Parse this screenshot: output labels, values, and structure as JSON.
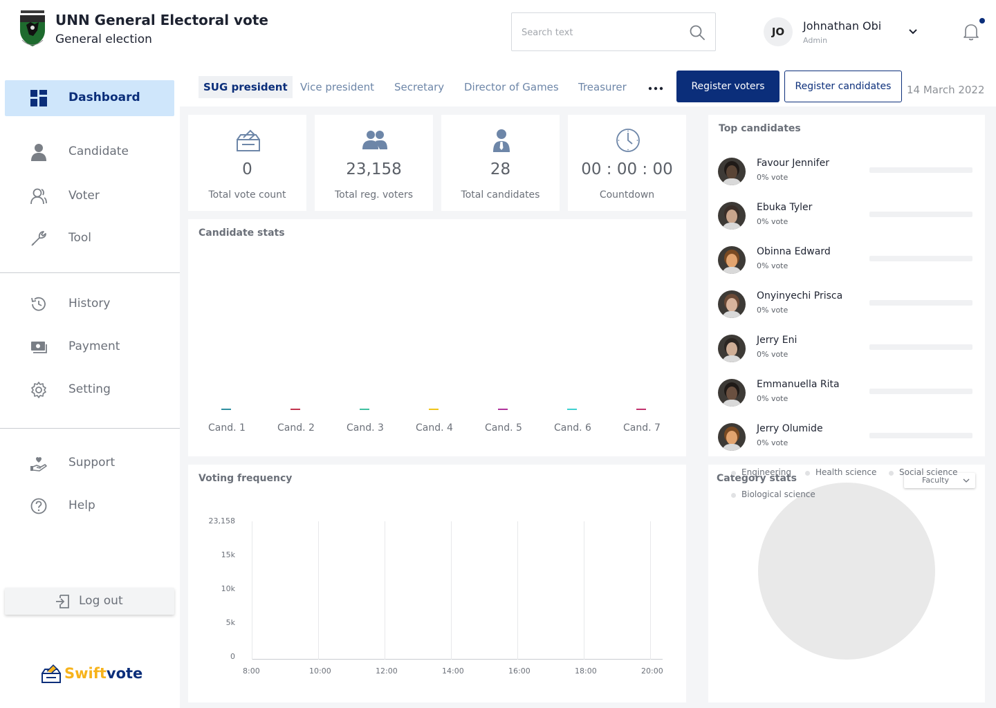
{
  "header": {
    "app_title": "UNN General Electoral vote",
    "app_subtitle": "General election",
    "search_placeholder": "Search text",
    "user": {
      "initials": "JO",
      "name": "Johnathan Obi",
      "role": "Admin"
    }
  },
  "sidebar": {
    "items": [
      {
        "label": "Dashboard",
        "icon": "dashboard-icon",
        "active": true
      },
      {
        "label": "Candidate",
        "icon": "candidate-icon"
      },
      {
        "label": "Voter",
        "icon": "voter-icon"
      },
      {
        "label": "Tool",
        "icon": "wrench-icon"
      },
      {
        "label": "History",
        "icon": "history-icon"
      },
      {
        "label": "Payment",
        "icon": "payment-icon"
      },
      {
        "label": "Setting",
        "icon": "gear-icon"
      },
      {
        "label": "Support",
        "icon": "support-icon"
      },
      {
        "label": "Help",
        "icon": "help-icon"
      }
    ],
    "logout_label": "Log out",
    "brand_a": "Swift",
    "brand_b": "vote"
  },
  "tabs": {
    "items": [
      "SUG president",
      "Vice president",
      "Secretary",
      "Director of Games",
      "Treasurer"
    ],
    "active": "SUG president",
    "register_voters": "Register voters",
    "register_candidates": "Register candidates",
    "date": "14 March 2022"
  },
  "stats": [
    {
      "value": "0",
      "label": "Total vote count",
      "icon": "ballot-box-icon"
    },
    {
      "value": "23,158",
      "label": "Total reg. voters",
      "icon": "users-icon"
    },
    {
      "value": "28",
      "label": "Total candidates",
      "icon": "user-tie-icon"
    },
    {
      "value": "00 : 00 : 00",
      "label": "Countdown",
      "icon": "clock-icon"
    }
  ],
  "candidate_stats": {
    "title": "Candidate stats",
    "chart_data": {
      "type": "bar",
      "categories": [
        "Cand. 1",
        "Cand. 2",
        "Cand. 3",
        "Cand. 4",
        "Cand. 5",
        "Cand. 6",
        "Cand. 7"
      ],
      "values": [
        0,
        0,
        0,
        0,
        0,
        0,
        0
      ],
      "colors": [
        "#2f8fa0",
        "#c2334d",
        "#3fc0a0",
        "#f0c419",
        "#b0339c",
        "#3fd0d0",
        "#c2336e"
      ]
    }
  },
  "voting_frequency": {
    "title": "Voting frequency",
    "chart_data": {
      "type": "line",
      "x": [
        "8:00",
        "10:00",
        "12:00",
        "14:00",
        "16:00",
        "18:00",
        "20:00"
      ],
      "y_ticks": [
        "23,158",
        "15k",
        "10k",
        "5k",
        "0"
      ],
      "ylim": [
        0,
        23158
      ],
      "series": [],
      "grid": "vertical"
    }
  },
  "top_candidates": {
    "title": "Top candidates",
    "items": [
      {
        "name": "Favour Jennifer",
        "pct": "0% vote",
        "value": 0,
        "skin": "#5a4536",
        "hair": "#1f1a17"
      },
      {
        "name": "Ebuka Tyler",
        "pct": "0% vote",
        "value": 0,
        "skin": "#c9a58c",
        "hair": "#3a2e28"
      },
      {
        "name": "Obinna Edward",
        "pct": "0% vote",
        "value": 0,
        "skin": "#e2a46f",
        "hair": "#7a4a22"
      },
      {
        "name": "Onyinyechi Prisca",
        "pct": "0% vote",
        "value": 0,
        "skin": "#d8b49c",
        "hair": "#6b4a36"
      },
      {
        "name": "Jerry Eni",
        "pct": "0% vote",
        "value": 0,
        "skin": "#cfae96",
        "hair": "#2c2622"
      },
      {
        "name": "Emmanuella Rita",
        "pct": "0% vote",
        "value": 0,
        "skin": "#6a5040",
        "hair": "#1f1a17"
      },
      {
        "name": "Jerry Olumide",
        "pct": "0% vote",
        "value": 0,
        "skin": "#e2a46f",
        "hair": "#7a4a22"
      }
    ]
  },
  "category_stats": {
    "title": "Category stats",
    "dropdown": "Faculty",
    "chart_data": {
      "type": "pie",
      "categories": [
        "Engineering",
        "Health science",
        "Social science",
        "Biological science"
      ],
      "values": [
        0,
        0,
        0,
        0
      ]
    }
  },
  "colors": {
    "primary": "#0b2e7a",
    "accent": "#f7b31b",
    "active_bg": "#cfe6fb"
  }
}
